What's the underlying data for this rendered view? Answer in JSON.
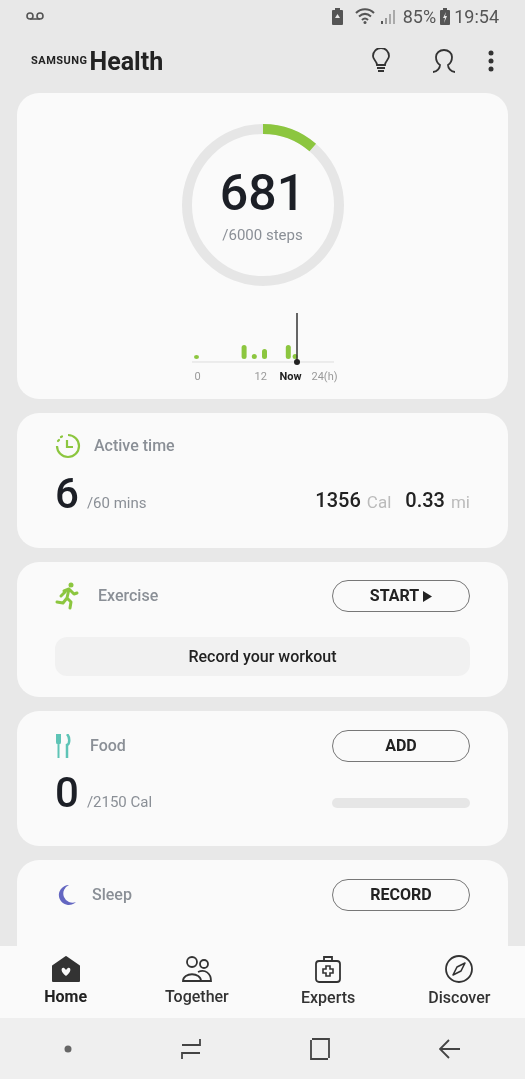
{
  "status_bar": {
    "battery": "85%",
    "time": "19:54"
  },
  "header": {
    "brand": "SAMSUNG",
    "title": "Health"
  },
  "steps": {
    "count": "681",
    "goal": "/6000 steps",
    "level": 0.1135,
    "axis_labels": [
      {
        "text": "0",
        "bold": false
      },
      {
        "text": "12",
        "bold": false
      },
      {
        "text": "Now",
        "bold": true
      },
      {
        "text": "24(h)",
        "bold": false
      }
    ]
  },
  "active_time": {
    "title": "Active time",
    "value": "6",
    "goal": "/60 mins",
    "calories": "1356",
    "calories_unit": "Cal",
    "distance": "0.33",
    "distance_unit": "mi"
  },
  "exercise": {
    "title": "Exercise",
    "button": "START",
    "action": "Record your workout"
  },
  "food": {
    "title": "Food",
    "button": "ADD",
    "value": "0",
    "goal": "/2150 Cal",
    "level": 0
  },
  "sleep": {
    "title": "Sleep",
    "button": "RECORD"
  },
  "nav": [
    {
      "label": "Home",
      "selected": true,
      "kind": "home"
    },
    {
      "label": "Together",
      "selected": false,
      "kind": "together"
    },
    {
      "label": "Experts",
      "selected": false,
      "kind": "experts"
    },
    {
      "label": "Discover",
      "selected": false,
      "kind": "discover"
    }
  ]
}
